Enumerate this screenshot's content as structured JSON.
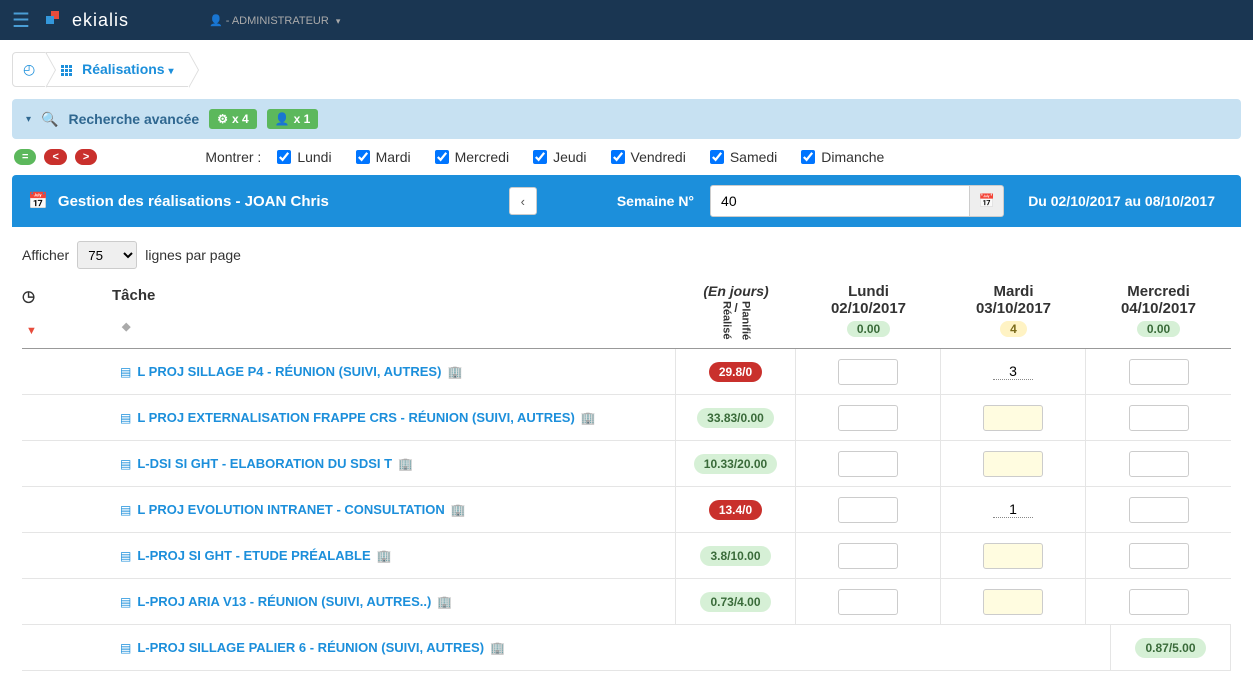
{
  "topbar": {
    "brand": "ekialis",
    "user_label": "- ADMINISTRATEUR"
  },
  "breadcrumb": {
    "current": "Réalisations"
  },
  "search": {
    "title": "Recherche avancée",
    "badge_gear": "x 4",
    "badge_user": "x 1"
  },
  "nav": {
    "eq": "=",
    "lt": "<",
    "gt": ">",
    "montrer": "Montrer :",
    "days": [
      "Lundi",
      "Mardi",
      "Mercredi",
      "Jeudi",
      "Vendredi",
      "Samedi",
      "Dimanche"
    ]
  },
  "header": {
    "title": "Gestion des réalisations -  JOAN Chris",
    "semaine_label": "Semaine N°",
    "week_value": "40",
    "date_range": "Du 02/10/2017 au 08/10/2017"
  },
  "pager": {
    "afficher": "Afficher",
    "value": "75",
    "suffix": "lignes par page"
  },
  "table": {
    "task_header": "Tâche",
    "unit_header": "(En jours)",
    "realise": "Réalisé",
    "slash": "/",
    "planifie": "Planifié",
    "columns": [
      {
        "name": "Lundi",
        "date": "02/10/2017",
        "val": "0.00",
        "style": "green"
      },
      {
        "name": "Mardi",
        "date": "03/10/2017",
        "val": "4",
        "style": "yellow"
      },
      {
        "name": "Mercredi",
        "date": "04/10/2017",
        "val": "0.00",
        "style": "green"
      }
    ],
    "rows": [
      {
        "task": "L PROJ SILLAGE P4 - RÉUNION (SUIVI, AUTRES)",
        "badge": "29.8/0",
        "badge_style": "red",
        "cells": [
          "",
          "3",
          ""
        ],
        "cell_type": [
          "input",
          "underline",
          "input"
        ]
      },
      {
        "task": "L PROJ EXTERNALISATION FRAPPE CRS - RÉUNION (SUIVI, AUTRES)",
        "badge": "33.83/0.00",
        "badge_style": "lgreen",
        "cells": [
          "",
          "",
          ""
        ],
        "cell_type": [
          "input",
          "yellow",
          "input"
        ]
      },
      {
        "task": "L-DSI SI GHT - ELABORATION DU SDSI T",
        "badge": "10.33/20.00",
        "badge_style": "lgreen",
        "cells": [
          "",
          "",
          ""
        ],
        "cell_type": [
          "input",
          "yellow",
          "input"
        ]
      },
      {
        "task": "L PROJ EVOLUTION INTRANET - CONSULTATION",
        "badge": "13.4/0",
        "badge_style": "red",
        "cells": [
          "",
          "1",
          ""
        ],
        "cell_type": [
          "input",
          "underline",
          "input"
        ]
      },
      {
        "task": "L-PROJ SI GHT - ETUDE PRÉALABLE",
        "badge": "3.8/10.00",
        "badge_style": "lgreen",
        "cells": [
          "",
          "",
          ""
        ],
        "cell_type": [
          "input",
          "yellow",
          "input"
        ]
      },
      {
        "task": "L-PROJ ARIA V13 - RÉUNION (SUIVI, AUTRES..)",
        "badge": "0.73/4.00",
        "badge_style": "lgreen",
        "cells": [
          "",
          "",
          ""
        ],
        "cell_type": [
          "input",
          "yellow",
          "input"
        ]
      },
      {
        "task": "L-PROJ SILLAGE PALIER 6 - RÉUNION (SUIVI, AUTRES)",
        "badge": "0.87/5.00",
        "badge_style": "lgreen",
        "cells": [],
        "cell_type": []
      }
    ]
  }
}
